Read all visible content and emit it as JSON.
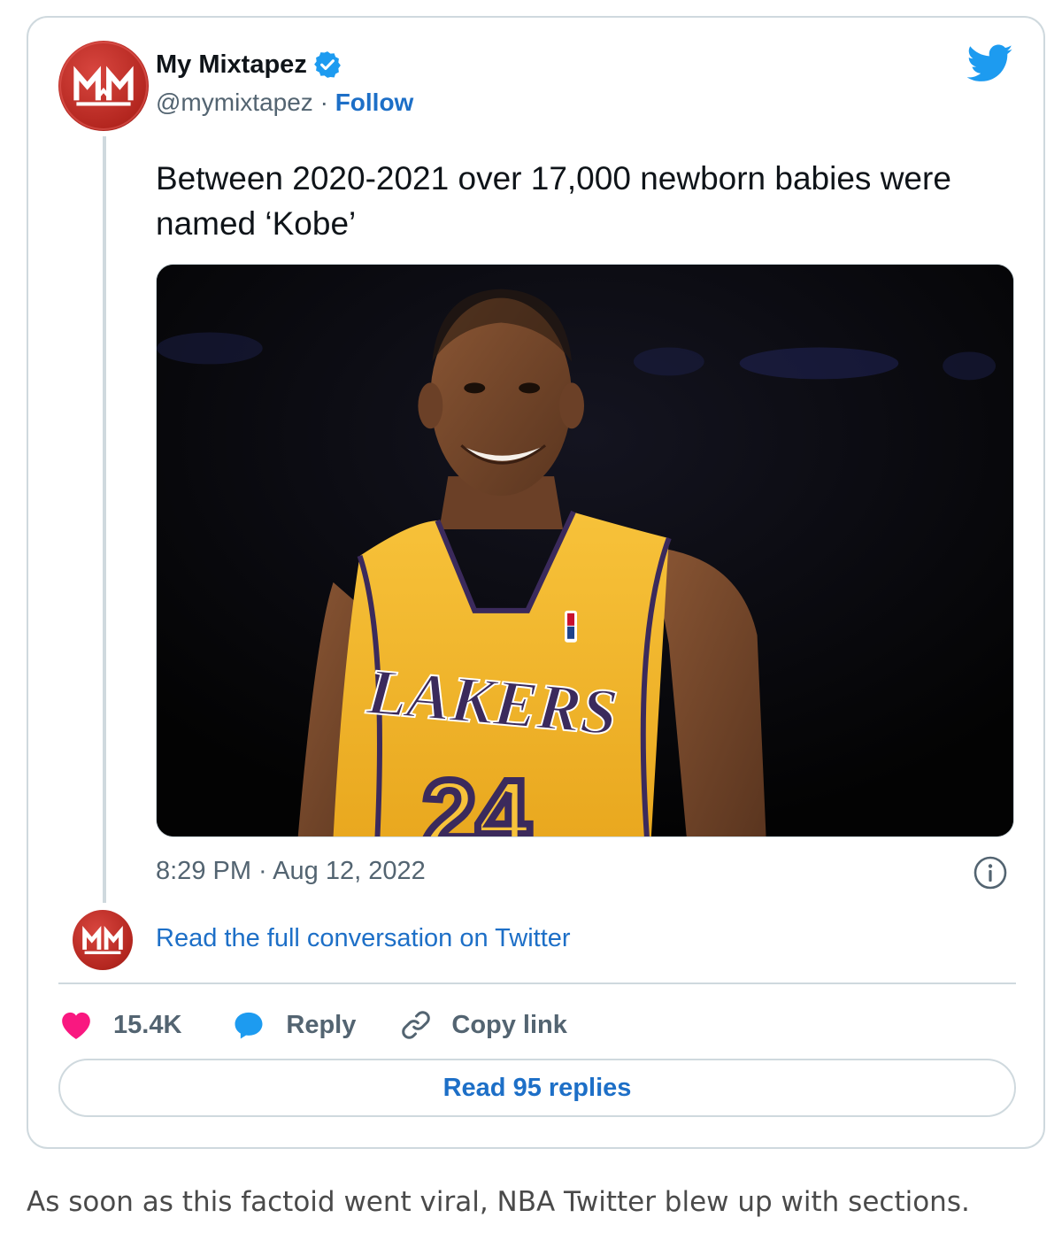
{
  "tweet": {
    "author": {
      "display_name": "My Mixtapez",
      "handle": "@mymixtapez",
      "separator": " · ",
      "follow_label": "Follow",
      "avatar_icon": "mymixtapez-logo-icon",
      "verified_icon": "verified-badge-icon"
    },
    "platform_icon": "twitter-bird-icon",
    "text": "Between 2020-2021 over 17,000 newborn babies were named ‘Kobe’",
    "media": {
      "kind": "photo",
      "jersey_text": "LAKERS",
      "jersey_number": "24"
    },
    "timestamp": "8:29 PM · Aug 12, 2022",
    "info_icon": "info-icon",
    "read_conversation_label": "Read the full conversation on Twitter",
    "actions": {
      "like_count": "15.4K",
      "reply_label": "Reply",
      "copy_link_label": "Copy link"
    },
    "read_replies_label": "Read 95 replies"
  },
  "caption": "As soon as this factoid went viral, NBA Twitter blew up with sections.",
  "colors": {
    "link_blue": "#1d6fc7",
    "twitter_blue": "#1d9bf0",
    "like_pink": "#f91880",
    "border": "#cfd9de",
    "avatar_red": "#b3261f",
    "jersey_gold": "#f5b82a",
    "jersey_purple": "#3b2a5c"
  }
}
